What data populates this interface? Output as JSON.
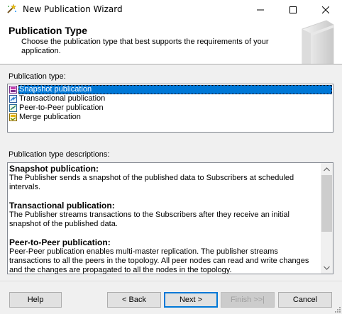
{
  "window": {
    "title": "New Publication Wizard",
    "icons": {
      "app": "wizard-icon",
      "minimize": "minimize-icon",
      "maximize": "maximize-icon",
      "close": "close-icon"
    }
  },
  "header": {
    "title": "Publication Type",
    "subtitle": "Choose the publication type that best supports the requirements of your application."
  },
  "publication_types": {
    "label": "Publication type:",
    "items": [
      {
        "label": "Snapshot publication",
        "icon": "snapshot-publication-icon",
        "selected": true
      },
      {
        "label": "Transactional publication",
        "icon": "transactional-publication-icon",
        "selected": false
      },
      {
        "label": "Peer-to-Peer publication",
        "icon": "peer-to-peer-publication-icon",
        "selected": false
      },
      {
        "label": "Merge publication",
        "icon": "merge-publication-icon",
        "selected": false
      }
    ]
  },
  "descriptions": {
    "label": "Publication type descriptions:",
    "sections": [
      {
        "heading": "Snapshot publication:",
        "text": "The Publisher sends a snapshot of the published data to Subscribers at scheduled intervals."
      },
      {
        "heading": "Transactional publication:",
        "text": "The Publisher streams transactions to the Subscribers after they receive an initial snapshot of the published data."
      },
      {
        "heading": "Peer-to-Peer publication:",
        "text": "Peer-Peer publication enables multi-master replication. The publisher streams transactions to all the peers in the topology. All peer nodes can read and write changes and the changes are propagated to all the nodes in the topology."
      }
    ]
  },
  "buttons": {
    "help": "Help",
    "back": "< Back",
    "next": "Next >",
    "finish": "Finish >>|",
    "cancel": "Cancel"
  },
  "colors": {
    "selection": "#0078d7",
    "dialog_bg": "#f0f0f0"
  }
}
